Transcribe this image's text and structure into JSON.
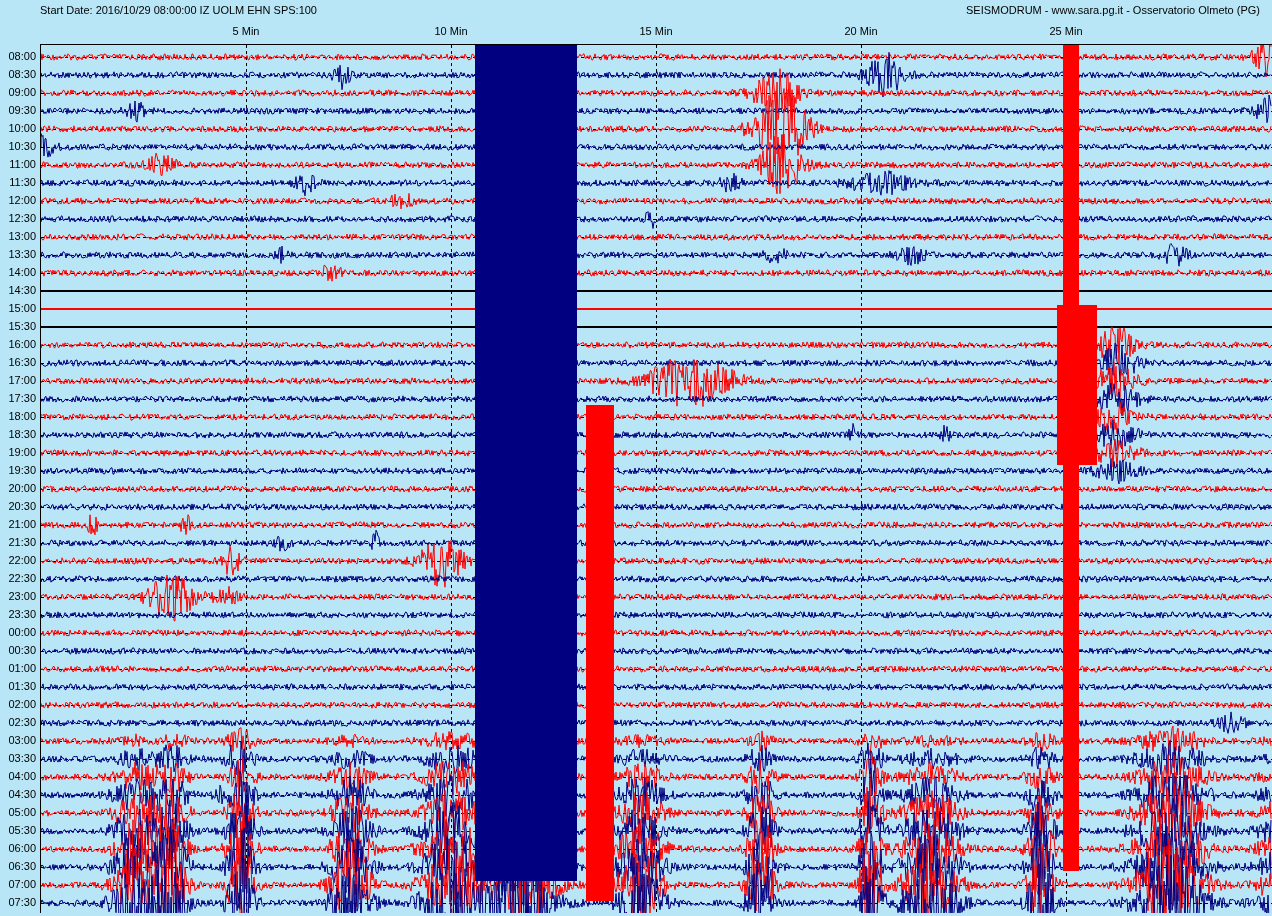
{
  "header": {
    "left": "Start Date: 2016/10/29 08:00:00 IZ UOLM EHN SPS:100",
    "right": "SEISMODRUM - www.sara.pg.it - Osservatorio Olmeto (PG)"
  },
  "x_ticks": [
    "5 Min",
    "10 Min",
    "15 Min",
    "20 Min",
    "25 Min"
  ],
  "rows": [
    {
      "label": "08:00",
      "kind": "trace",
      "color": "#ff0000"
    },
    {
      "label": "08:30",
      "kind": "trace",
      "color": "#000080"
    },
    {
      "label": "09:00",
      "kind": "trace",
      "color": "#ff0000"
    },
    {
      "label": "09:30",
      "kind": "trace",
      "color": "#000080"
    },
    {
      "label": "10:00",
      "kind": "trace",
      "color": "#ff0000"
    },
    {
      "label": "10:30",
      "kind": "trace",
      "color": "#000080"
    },
    {
      "label": "11:00",
      "kind": "trace",
      "color": "#ff0000"
    },
    {
      "label": "11:30",
      "kind": "trace",
      "color": "#000080"
    },
    {
      "label": "12:00",
      "kind": "trace",
      "color": "#ff0000"
    },
    {
      "label": "12:30",
      "kind": "trace",
      "color": "#000080"
    },
    {
      "label": "13:00",
      "kind": "trace",
      "color": "#ff0000"
    },
    {
      "label": "13:30",
      "kind": "trace",
      "color": "#000080"
    },
    {
      "label": "14:00",
      "kind": "trace",
      "color": "#ff0000"
    },
    {
      "label": "14:30",
      "kind": "flat"
    },
    {
      "label": "15:00",
      "kind": "flat",
      "color": "#ff0000"
    },
    {
      "label": "15:30",
      "kind": "flat"
    },
    {
      "label": "16:00",
      "kind": "trace",
      "color": "#ff0000"
    },
    {
      "label": "16:30",
      "kind": "trace",
      "color": "#000080"
    },
    {
      "label": "17:00",
      "kind": "trace",
      "color": "#ff0000"
    },
    {
      "label": "17:30",
      "kind": "trace",
      "color": "#000080"
    },
    {
      "label": "18:00",
      "kind": "trace",
      "color": "#ff0000"
    },
    {
      "label": "18:30",
      "kind": "trace",
      "color": "#000080"
    },
    {
      "label": "19:00",
      "kind": "trace",
      "color": "#ff0000"
    },
    {
      "label": "19:30",
      "kind": "trace",
      "color": "#000080"
    },
    {
      "label": "20:00",
      "kind": "trace",
      "color": "#ff0000"
    },
    {
      "label": "20:30",
      "kind": "trace",
      "color": "#000080"
    },
    {
      "label": "21:00",
      "kind": "trace",
      "color": "#ff0000"
    },
    {
      "label": "21:30",
      "kind": "trace",
      "color": "#000080"
    },
    {
      "label": "22:00",
      "kind": "trace",
      "color": "#ff0000"
    },
    {
      "label": "22:30",
      "kind": "trace",
      "color": "#000080"
    },
    {
      "label": "23:00",
      "kind": "trace",
      "color": "#ff0000"
    },
    {
      "label": "23:30",
      "kind": "trace",
      "color": "#000080"
    },
    {
      "label": "00:00",
      "kind": "trace",
      "color": "#ff0000"
    },
    {
      "label": "00:30",
      "kind": "trace",
      "color": "#000080"
    },
    {
      "label": "01:00",
      "kind": "trace",
      "color": "#ff0000"
    },
    {
      "label": "01:30",
      "kind": "trace",
      "color": "#000080"
    },
    {
      "label": "02:00",
      "kind": "trace",
      "color": "#ff0000"
    },
    {
      "label": "02:30",
      "kind": "trace",
      "color": "#000080"
    },
    {
      "label": "03:00",
      "kind": "trace",
      "color": "#ff0000"
    },
    {
      "label": "03:30",
      "kind": "trace",
      "color": "#000080"
    },
    {
      "label": "04:00",
      "kind": "trace",
      "color": "#ff0000"
    },
    {
      "label": "04:30",
      "kind": "trace",
      "color": "#000080"
    },
    {
      "label": "05:00",
      "kind": "trace",
      "color": "#ff0000"
    },
    {
      "label": "05:30",
      "kind": "trace",
      "color": "#000080"
    },
    {
      "label": "06:00",
      "kind": "trace",
      "color": "#ff0000"
    },
    {
      "label": "06:30",
      "kind": "trace",
      "color": "#000080"
    },
    {
      "label": "07:00",
      "kind": "trace",
      "color": "#ff0000"
    },
    {
      "label": "07:30",
      "kind": "trace",
      "color": "#000080"
    }
  ]
}
